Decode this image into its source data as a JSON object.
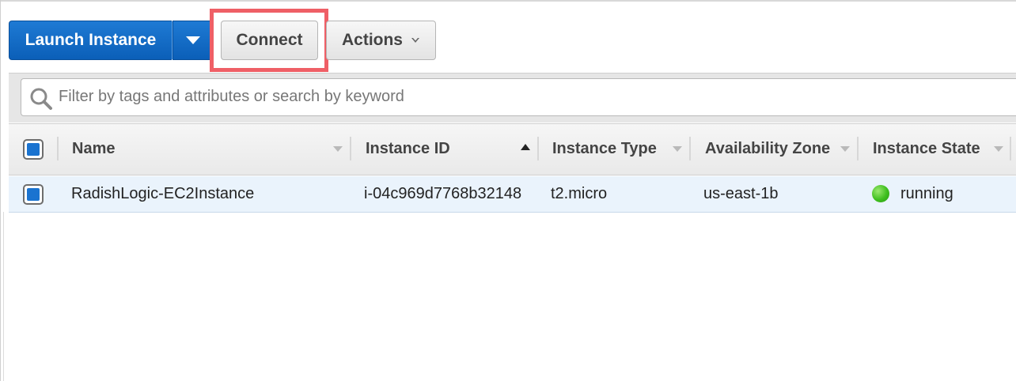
{
  "toolbar": {
    "launch_label": "Launch Instance",
    "connect_label": "Connect",
    "actions_label": "Actions"
  },
  "search": {
    "placeholder": "Filter by tags and attributes or search by keyword"
  },
  "table": {
    "columns": [
      {
        "label": "Name",
        "sort": "none"
      },
      {
        "label": "Instance ID",
        "sort": "ascending"
      },
      {
        "label": "Instance Type",
        "sort": "none"
      },
      {
        "label": "Availability Zone",
        "sort": "none"
      },
      {
        "label": "Instance State",
        "sort": "none"
      }
    ],
    "rows": [
      {
        "selected": true,
        "name": "RadishLogic-EC2Instance",
        "instance_id": "i-04c969d7768b32148",
        "instance_type": "t2.micro",
        "availability_zone": "us-east-1b",
        "instance_state": "running"
      }
    ]
  },
  "colors": {
    "primary_button": "#1a73d0",
    "highlight": "#ef5f66",
    "running_status": "#3fbf1f",
    "selected_row": "#eaf3fc"
  },
  "icons": [
    "caret-down-icon",
    "chevron-down-icon",
    "search-icon",
    "sort-arrow-icon",
    "status-running-icon"
  ]
}
